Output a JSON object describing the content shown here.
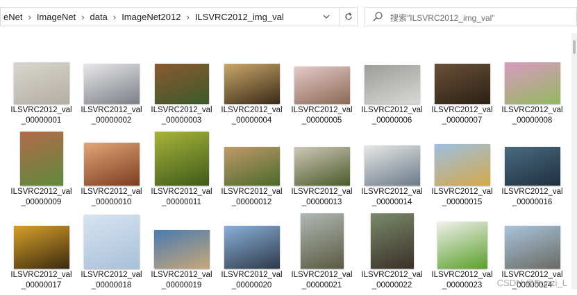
{
  "address_bar": {
    "breadcrumbs": [
      "eNet",
      "ImageNet",
      "data",
      "ImageNet2012",
      "ILSVRC2012_img_val"
    ],
    "separator": "›"
  },
  "search": {
    "placeholder": "搜索\"ILSVRC2012_img_val\""
  },
  "files": [
    {
      "name1": "ILSVRC2012_val",
      "name2": "_00000001",
      "icon": "thumbnail-sand-turtle",
      "c1": "#d8d6cf",
      "c2": "#b4aea3"
    },
    {
      "name1": "ILSVRC2012_val",
      "name2": "_00000002",
      "icon": "thumbnail-snow-people",
      "c1": "#e8e8ea",
      "c2": "#7c7f86"
    },
    {
      "name1": "ILSVRC2012_val",
      "name2": "_00000003",
      "icon": "thumbnail-collie-dog",
      "c1": "#8a5a30",
      "c2": "#3c5a2a"
    },
    {
      "name1": "ILSVRC2012_val",
      "name2": "_00000004",
      "icon": "thumbnail-bowl",
      "c1": "#caa86a",
      "c2": "#3a2a18"
    },
    {
      "name1": "ILSVRC2012_val",
      "name2": "_00000005",
      "icon": "thumbnail-teddy-bed",
      "c1": "#e5c9c8",
      "c2": "#8b6a55"
    },
    {
      "name1": "ILSVRC2012_val",
      "name2": "_00000006",
      "icon": "thumbnail-snake-road",
      "c1": "#9c9c98",
      "c2": "#d8d8d6"
    },
    {
      "name1": "ILSVRC2012_val",
      "name2": "_00000007",
      "icon": "thumbnail-cat",
      "c1": "#6a5038",
      "c2": "#2c2014"
    },
    {
      "name1": "ILSVRC2012_val",
      "name2": "_00000008",
      "icon": "thumbnail-macarons",
      "c1": "#d89ac0",
      "c2": "#94b860"
    },
    {
      "name1": "ILSVRC2012_val",
      "name2": "_00000009",
      "icon": "thumbnail-birdhouse",
      "c1": "#b26a4a",
      "c2": "#5e8a3c"
    },
    {
      "name1": "ILSVRC2012_val",
      "name2": "_00000010",
      "icon": "thumbnail-hamster",
      "c1": "#e2a678",
      "c2": "#7a3e20"
    },
    {
      "name1": "ILSVRC2012_val",
      "name2": "_00000011",
      "icon": "thumbnail-lemon",
      "c1": "#a8b43a",
      "c2": "#3f5a1a"
    },
    {
      "name1": "ILSVRC2012_val",
      "name2": "_00000012",
      "icon": "thumbnail-cougar",
      "c1": "#c09a6a",
      "c2": "#4a6a2a"
    },
    {
      "name1": "ILSVRC2012_val",
      "name2": "_00000013",
      "icon": "thumbnail-monkey",
      "c1": "#cfc8b8",
      "c2": "#4a5a2a"
    },
    {
      "name1": "ILSVRC2012_val",
      "name2": "_00000014",
      "icon": "thumbnail-rv",
      "c1": "#e8e8e4",
      "c2": "#6a7a8a"
    },
    {
      "name1": "ILSVRC2012_val",
      "name2": "_00000015",
      "icon": "thumbnail-wheat-field",
      "c1": "#9ec0e0",
      "c2": "#d4a84a"
    },
    {
      "name1": "ILSVRC2012_val",
      "name2": "_00000016",
      "icon": "thumbnail-whale",
      "c1": "#4a6a80",
      "c2": "#1e3040"
    },
    {
      "name1": "ILSVRC2012_val",
      "name2": "_00000017",
      "icon": "thumbnail-starfish",
      "c1": "#d8a02a",
      "c2": "#3a2a10"
    },
    {
      "name1": "ILSVRC2012_val",
      "name2": "_00000018",
      "icon": "thumbnail-bird-sky",
      "c1": "#d6e4f2",
      "c2": "#a8c0d8"
    },
    {
      "name1": "ILSVRC2012_val",
      "name2": "_00000019",
      "icon": "thumbnail-box",
      "c1": "#4a7ab0",
      "c2": "#c8a878"
    },
    {
      "name1": "ILSVRC2012_val",
      "name2": "_00000020",
      "icon": "thumbnail-tower",
      "c1": "#8ab0d8",
      "c2": "#2e3a4a"
    },
    {
      "name1": "ILSVRC2012_val",
      "name2": "_00000021",
      "icon": "thumbnail-tree",
      "c1": "#b0b8b4",
      "c2": "#5a5a40"
    },
    {
      "name1": "ILSVRC2012_val",
      "name2": "_00000022",
      "icon": "thumbnail-man-dog",
      "c1": "#7a8a6a",
      "c2": "#3a3028"
    },
    {
      "name1": "ILSVRC2012_val",
      "name2": "_00000023",
      "icon": "thumbnail-apples",
      "c1": "#f0f0ec",
      "c2": "#5aa02a"
    },
    {
      "name1": "ILSVRC2012_val",
      "name2": "_00000024",
      "icon": "thumbnail-planetarium",
      "c1": "#a8c4dc",
      "c2": "#6a6a62"
    }
  ],
  "watermark": "CSDN @Runzi_L"
}
